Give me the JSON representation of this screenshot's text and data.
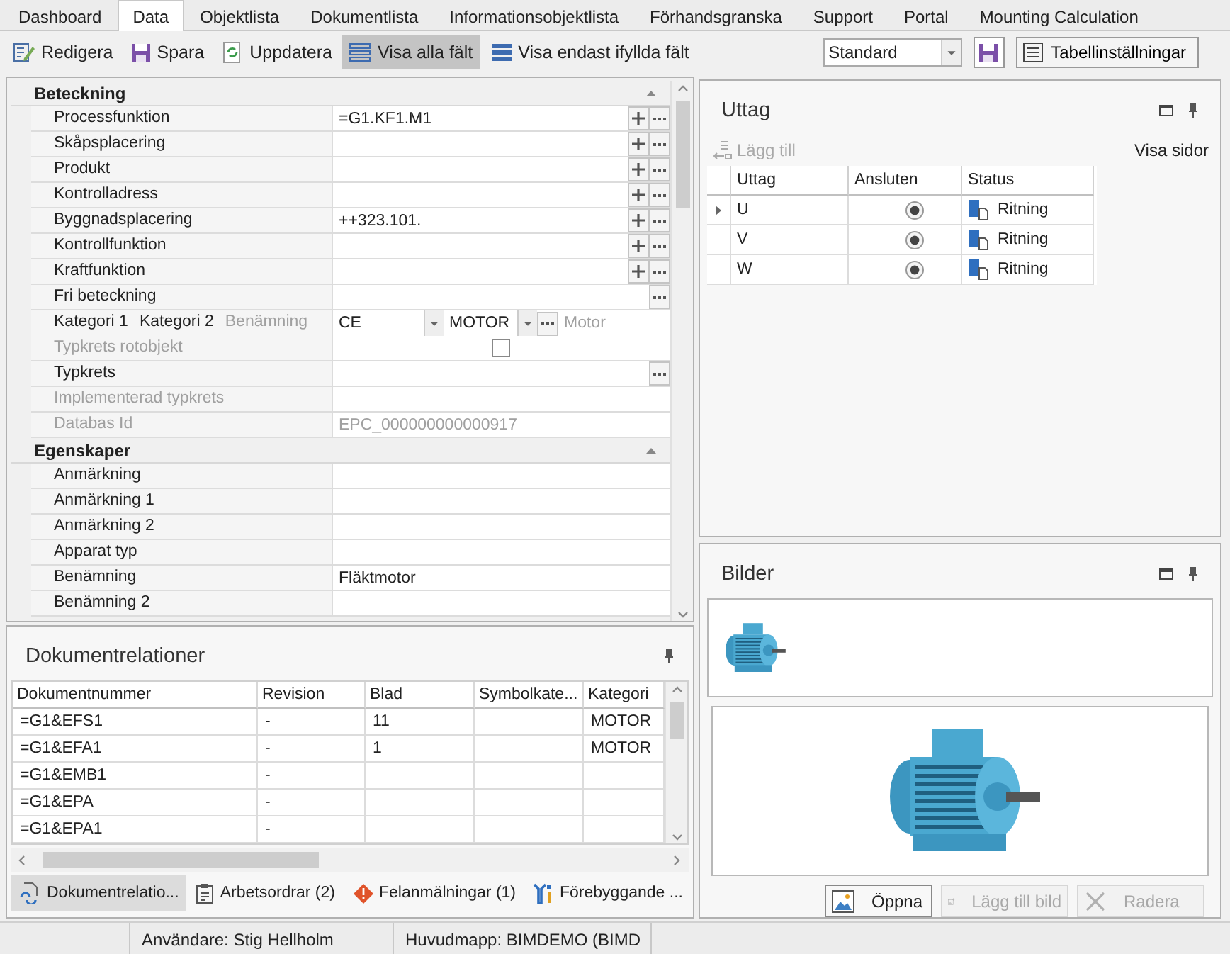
{
  "tabs": [
    {
      "label": "Dashboard",
      "selected": false
    },
    {
      "label": "Data",
      "selected": true
    },
    {
      "label": "Objektlista",
      "selected": false
    },
    {
      "label": "Dokumentlista",
      "selected": false
    },
    {
      "label": "Informationsobjektlista",
      "selected": false
    },
    {
      "label": "Förhandsgranska",
      "selected": false
    },
    {
      "label": "Support",
      "selected": false
    },
    {
      "label": "Portal",
      "selected": false
    },
    {
      "label": "Mounting Calculation",
      "selected": false
    }
  ],
  "toolbar": {
    "buttons": [
      {
        "label": "Redigera",
        "kind": "edit",
        "selected": false
      },
      {
        "label": "Spara",
        "kind": "save",
        "selected": false
      },
      {
        "label": "Uppdatera",
        "kind": "refresh",
        "selected": false
      },
      {
        "label": "Visa alla fält",
        "kind": "list",
        "selected": true
      },
      {
        "label": "Visa endast ifyllda fält",
        "kind": "list-filled",
        "selected": false
      }
    ],
    "view_select": {
      "value": "Standard"
    },
    "table_settings": {
      "label": "Tabellinställningar"
    }
  },
  "property_grid": {
    "sections": [
      {
        "title": "Beteckning",
        "expanded": true,
        "rows": [
          {
            "kind": "field",
            "label": "Processfunktion",
            "value": "=G1.KF1.M1",
            "plus": true,
            "more": true
          },
          {
            "kind": "field",
            "label": "Skåpsplacering",
            "plus": true,
            "more": true
          },
          {
            "kind": "field",
            "label": "Produkt",
            "plus": true,
            "more": true
          },
          {
            "kind": "field",
            "label": "Kontrolladress",
            "plus": true,
            "more": true
          },
          {
            "kind": "field",
            "label": "Byggnadsplacering",
            "value": "++323.101.",
            "plus": true,
            "more": true
          },
          {
            "kind": "field",
            "label": "Kontrollfunktion",
            "plus": true,
            "more": true
          },
          {
            "kind": "field",
            "label": "Kraftfunktion",
            "plus": true,
            "more": true
          },
          {
            "kind": "field",
            "label": "Fri beteckning",
            "plus": false,
            "more": true
          },
          {
            "kind": "category",
            "labels": [
              {
                "text": "Kategori 1",
                "disabled": false
              },
              {
                "text": "Kategori 2",
                "disabled": false
              },
              {
                "text": "Benämning",
                "disabled": true
              }
            ],
            "category_1": "CE",
            "category_2": "MOTOR",
            "description": "Motor"
          },
          {
            "kind": "checkbox",
            "label": "Typkrets rotobjekt",
            "disabled": true,
            "checked": false
          },
          {
            "kind": "field",
            "label": "Typkrets",
            "plus": false,
            "more": true
          },
          {
            "kind": "field",
            "label": "Implementerad typkrets",
            "disabled": true,
            "plus": false,
            "more": false
          },
          {
            "kind": "field",
            "label": "Databas Id",
            "value": "EPC_000000000000917",
            "disabled": true,
            "plus": false,
            "more": false
          }
        ]
      },
      {
        "title": "Egenskaper",
        "expanded": true,
        "rows": [
          {
            "kind": "field",
            "label": "Anmärkning",
            "plus": false,
            "more": false
          },
          {
            "kind": "field",
            "label": "Anmärkning 1",
            "plus": false,
            "more": false
          },
          {
            "kind": "field",
            "label": "Anmärkning 2",
            "plus": false,
            "more": false
          },
          {
            "kind": "field",
            "label": "Apparat typ",
            "plus": false,
            "more": false
          },
          {
            "kind": "field",
            "label": "Benämning",
            "value": "Fläktmotor",
            "plus": false,
            "more": false
          },
          {
            "kind": "field",
            "label": "Benämning 2",
            "plus": false,
            "more": false
          }
        ]
      }
    ]
  },
  "document_relations": {
    "title": "Dokumentrelationer",
    "columns": [
      "Dokumentnummer",
      "Revision",
      "Blad",
      "Symbolkate...",
      "Kategori"
    ],
    "rows": [
      [
        "=G1&EFS1",
        "-",
        "11",
        "",
        "MOTOR"
      ],
      [
        "=G1&EFA1",
        "-",
        "1",
        "",
        "MOTOR"
      ],
      [
        "=G1&EMB1",
        "-",
        "",
        "",
        ""
      ],
      [
        "=G1&EPA",
        "-",
        "",
        "",
        ""
      ],
      [
        "=G1&EPA1",
        "-",
        "",
        "",
        ""
      ]
    ],
    "tabs": [
      {
        "label": "Dokumentrelatio...",
        "kind": "documents",
        "selected": true
      },
      {
        "label": "Arbetsordrar (2)",
        "kind": "clipboard",
        "selected": false
      },
      {
        "label": "Felanmälningar (1)",
        "kind": "warning",
        "selected": false
      },
      {
        "label": "Förebyggande ...",
        "kind": "tools",
        "selected": false
      }
    ]
  },
  "outlets": {
    "title": "Uttag",
    "add_button": {
      "label": "Lägg till",
      "disabled": true
    },
    "pages_link": "Visa sidor",
    "columns": [
      "Uttag",
      "Ansluten",
      "Status"
    ],
    "rows": [
      {
        "name": "U",
        "current": true,
        "connected": true,
        "status": "Ritning"
      },
      {
        "name": "V",
        "current": false,
        "connected": true,
        "status": "Ritning"
      },
      {
        "name": "W",
        "current": false,
        "connected": true,
        "status": "Ritning"
      }
    ]
  },
  "images": {
    "title": "Bilder",
    "buttons": [
      {
        "label": "Öppna",
        "kind": "open",
        "disabled": false
      },
      {
        "label": "Lägg till bild",
        "kind": "add",
        "disabled": true
      },
      {
        "label": "Radera",
        "kind": "delete",
        "disabled": true
      }
    ]
  },
  "status_bar": [
    "Användare: Stig Hellholm",
    "Huvudmapp: BIMDEMO (BIMD"
  ]
}
